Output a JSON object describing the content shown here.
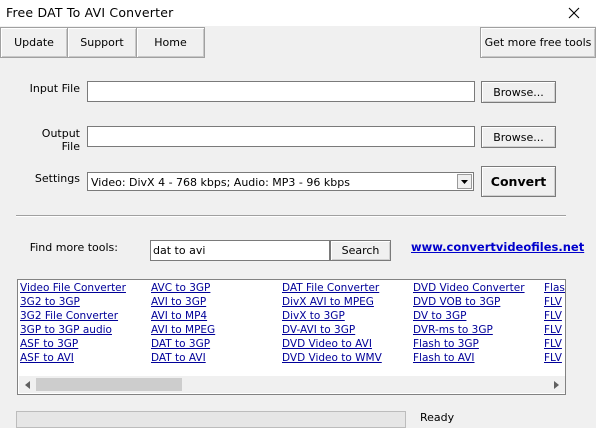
{
  "window": {
    "title": "Free DAT To AVI Converter"
  },
  "toolbar": {
    "update": "Update",
    "support": "Support",
    "home": "Home",
    "more_tools": "Get more free tools"
  },
  "form": {
    "input_label": "Input File",
    "input_value": "",
    "output_label": "Output File",
    "output_value": "",
    "browse_label": "Browse...",
    "settings_label": "Settings",
    "settings_value": "Video: DivX 4 - 768 kbps; Audio: MP3 - 96 kbps",
    "convert_label": "Convert"
  },
  "find": {
    "label": "Find more tools:",
    "query": "dat to avi",
    "search_label": "Search",
    "website": "www.convertvideofiles.net"
  },
  "tools": [
    [
      "Video File Converter",
      "3G2 to 3GP",
      "3G2 File Converter",
      "3GP to 3GP audio",
      "ASF to 3GP",
      "ASF to AVI"
    ],
    [
      "AVC to 3GP",
      "AVI to 3GP",
      "AVI to MP4",
      "AVI to MPEG",
      "DAT to 3GP",
      "DAT to AVI"
    ],
    [
      "DAT File Converter",
      "DivX AVI to MPEG",
      "DivX to 3GP",
      "DV-AVI to 3GP",
      "DVD Video to AVI",
      "DVD Video to WMV"
    ],
    [
      "DVD Video Converter",
      "DVD VOB to 3GP",
      "DV to 3GP",
      "DVR-ms to 3GP",
      "Flash to 3GP",
      "Flash to AVI"
    ],
    [
      "Flash",
      "FLV",
      "FLV",
      "FLV",
      "FLV",
      "FLV"
    ]
  ],
  "status": {
    "text": "Ready"
  }
}
